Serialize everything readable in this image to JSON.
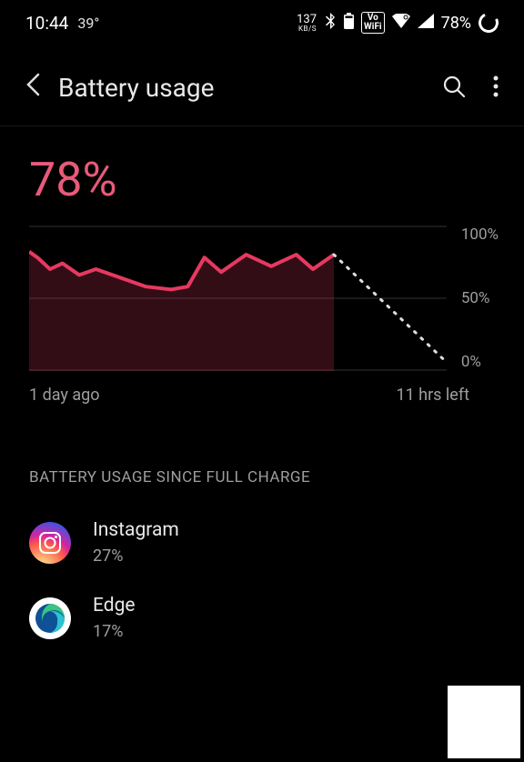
{
  "status": {
    "time": "10:44",
    "temp": "39°",
    "kbs_top": "137",
    "kbs_bot": "KB/S",
    "vowifi": "Vo\nWiFi",
    "battery_pct": "78%"
  },
  "header": {
    "title": "Battery usage"
  },
  "battery": {
    "percent": "78%"
  },
  "chart_data": {
    "type": "line",
    "title": "",
    "xlabel": "",
    "ylabel": "",
    "ylim": [
      0,
      100
    ],
    "y_ticks": [
      "100%",
      "50%",
      "0%"
    ],
    "x_range_labels": {
      "start": "1 day ago",
      "end": "11 hrs left"
    },
    "series": [
      {
        "name": "history",
        "style": "solid",
        "color": "#e63960",
        "x": [
          0,
          2,
          5,
          8,
          12,
          16,
          22,
          28,
          34,
          38,
          42,
          46,
          52,
          58,
          64,
          68,
          73
        ],
        "values": [
          82,
          78,
          70,
          74,
          66,
          70,
          64,
          58,
          56,
          58,
          78,
          68,
          80,
          72,
          80,
          70,
          80
        ]
      },
      {
        "name": "projection",
        "style": "dotted",
        "color": "#dddddd",
        "x": [
          73,
          100
        ],
        "values": [
          80,
          6
        ]
      }
    ]
  },
  "chart_x": {
    "start": "1 day ago",
    "end": "11 hrs left"
  },
  "section": {
    "title": "BATTERY USAGE SINCE FULL CHARGE"
  },
  "apps": [
    {
      "name": "Instagram",
      "pct": "27%",
      "icon": "instagram"
    },
    {
      "name": "Edge",
      "pct": "17%",
      "icon": "edge"
    }
  ]
}
